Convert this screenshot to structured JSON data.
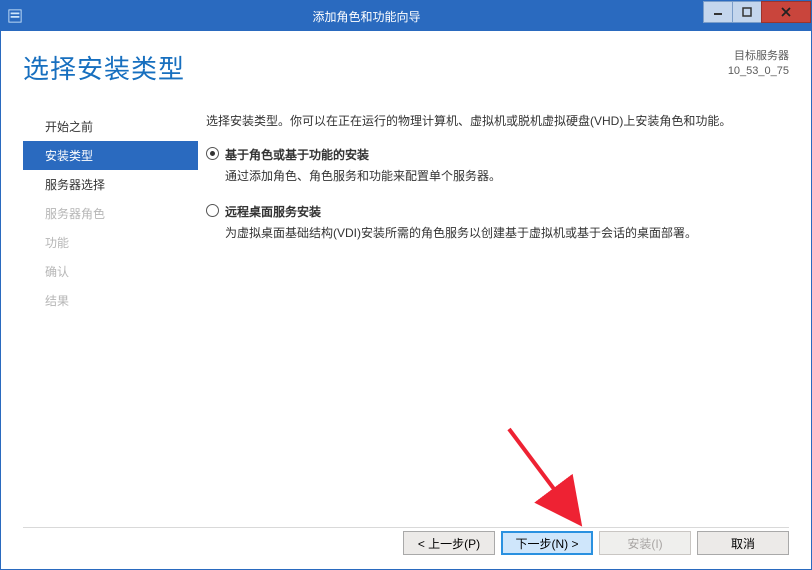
{
  "window": {
    "title": "添加角色和功能向导"
  },
  "header": {
    "page_title": "选择安装类型",
    "dest_label": "目标服务器",
    "dest_value": "10_53_0_75"
  },
  "sidebar": {
    "items": [
      {
        "label": "开始之前",
        "state": "normal"
      },
      {
        "label": "安装类型",
        "state": "active"
      },
      {
        "label": "服务器选择",
        "state": "normal"
      },
      {
        "label": "服务器角色",
        "state": "disabled"
      },
      {
        "label": "功能",
        "state": "disabled"
      },
      {
        "label": "确认",
        "state": "disabled"
      },
      {
        "label": "结果",
        "state": "disabled"
      }
    ]
  },
  "content": {
    "intro": "选择安装类型。你可以在正在运行的物理计算机、虚拟机或脱机虚拟硬盘(VHD)上安装角色和功能。",
    "options": [
      {
        "checked": true,
        "title": "基于角色或基于功能的安装",
        "desc": "通过添加角色、角色服务和功能来配置单个服务器。"
      },
      {
        "checked": false,
        "title": "远程桌面服务安装",
        "desc": "为虚拟桌面基础结构(VDI)安装所需的角色服务以创建基于虚拟机或基于会话的桌面部署。"
      }
    ]
  },
  "footer": {
    "prev": "< 上一步(P)",
    "next": "下一步(N) >",
    "install": "安装(I)",
    "cancel": "取消"
  }
}
